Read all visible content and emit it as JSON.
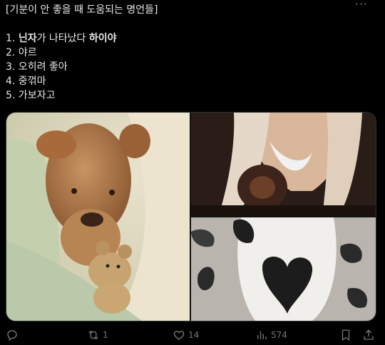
{
  "post": {
    "lines": [
      [
        {
          "text": "[기분이 안 좋을 때 도움되는 명언들]",
          "bold": false
        }
      ],
      [
        {
          "text": "",
          "bold": false
        }
      ],
      [
        {
          "text": "1. ",
          "bold": false
        },
        {
          "text": "닌자",
          "bold": true
        },
        {
          "text": "가 나타났다 ",
          "bold": false
        },
        {
          "text": "하이야",
          "bold": true
        }
      ],
      [
        {
          "text": "2. 야르",
          "bold": false
        }
      ],
      [
        {
          "text": "3. 오히려 좋아",
          "bold": false
        }
      ],
      [
        {
          "text": "4. 중꺾마",
          "bold": false
        }
      ],
      [
        {
          "text": "5. 가보자고",
          "bold": false
        }
      ]
    ]
  },
  "actions": {
    "reply_count": "",
    "repost_count": "1",
    "like_count": "14",
    "views_count": "574"
  },
  "colors": {
    "background": "#000000",
    "text": "#e7e9ea",
    "muted": "#71767b"
  },
  "icons": [
    "more-icon",
    "reply-icon",
    "repost-icon",
    "like-icon",
    "views-icon",
    "bookmark-icon",
    "share-icon"
  ]
}
